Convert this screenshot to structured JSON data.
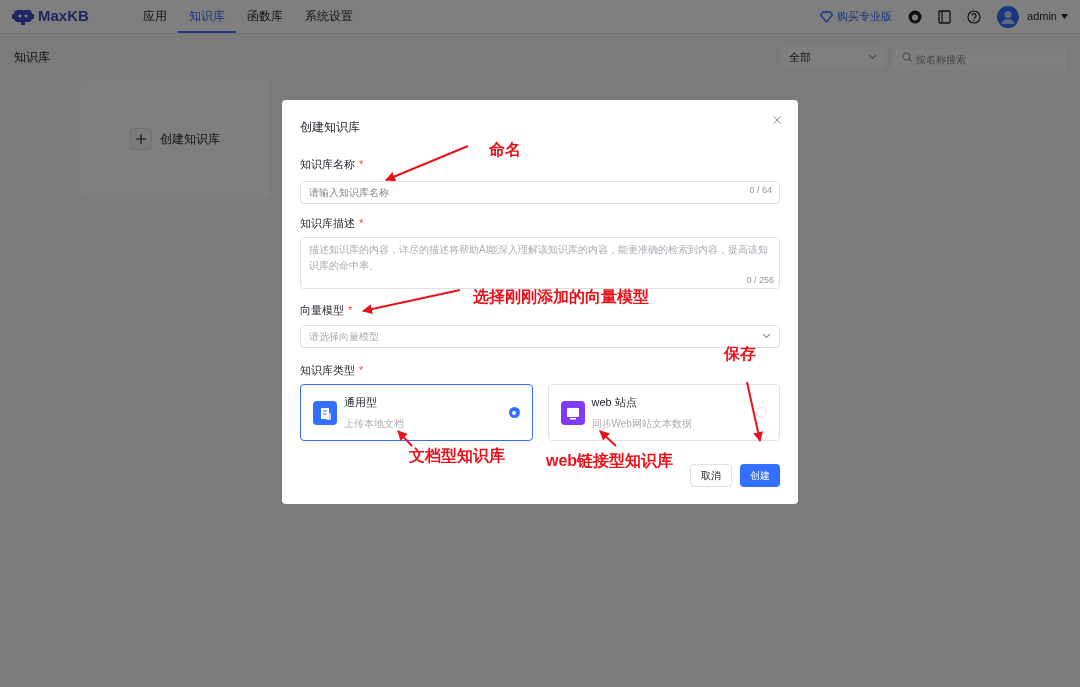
{
  "header": {
    "logo": "MaxKB",
    "nav": [
      {
        "label": "应用",
        "selected": false
      },
      {
        "label": "知识库",
        "selected": true
      },
      {
        "label": "函数库",
        "selected": false
      },
      {
        "label": "系统设置",
        "selected": false
      }
    ],
    "pro_link": "购买专业版",
    "user": "admin"
  },
  "subheader": {
    "title": "知识库",
    "filter": "全部",
    "search_placeholder": "按名称搜索"
  },
  "create_card": {
    "label": "创建知识库"
  },
  "dialog": {
    "title": "创建知识库",
    "name_field": {
      "label": "知识库名称",
      "required_mark": "*",
      "placeholder": "请输入知识库名称",
      "counter": "0 / 64"
    },
    "description_field": {
      "label": "知识库描述",
      "required_mark": "*",
      "placeholder": "描述知识库的内容，详尽的描述将帮助AI能深入理解该知识库的内容，能更准确的检索到内容，提高该知识库的命中率。",
      "counter": "0 / 256"
    },
    "model_field": {
      "label": "向量模型",
      "required_mark": "*",
      "placeholder": "请选择向量模型"
    },
    "type_field": {
      "label": "知识库类型",
      "required_mark": "*",
      "options": [
        {
          "kind": "document",
          "title": "通用型",
          "subtitle": "上传本地文档",
          "selected": true
        },
        {
          "kind": "web",
          "title": "web 站点",
          "subtitle": "同步Web网站文本数据",
          "selected": false
        }
      ]
    },
    "buttons": {
      "cancel": "取消",
      "create": "创建"
    }
  },
  "annotations": [
    "命名",
    "选择刚刚添加的向量模型",
    "保存",
    "文档型知识库",
    "web链接型知识库"
  ]
}
